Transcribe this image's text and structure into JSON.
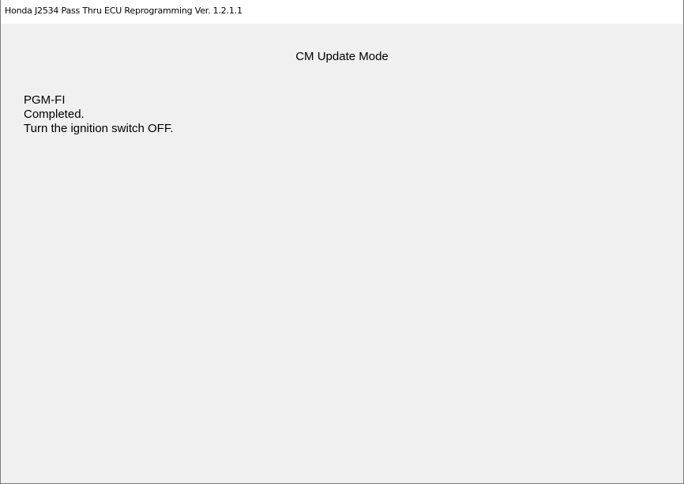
{
  "window": {
    "title": "Honda J2534 Pass Thru ECU Reprogramming Ver. 1.2.1.1"
  },
  "main": {
    "mode_title": "CM Update Mode",
    "message_lines": [
      "PGM-FI",
      "Completed.",
      "Turn the ignition switch OFF."
    ]
  }
}
